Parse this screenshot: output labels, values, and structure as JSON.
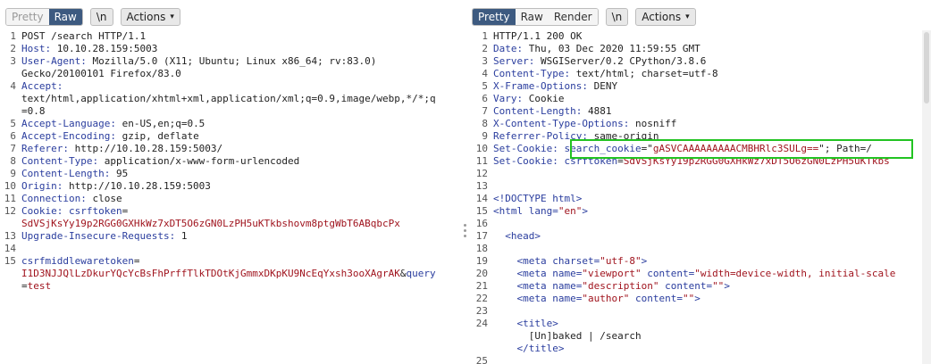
{
  "request": {
    "toolbar": {
      "pretty": "Pretty",
      "raw": "Raw",
      "newline": "\\n",
      "actions": "Actions"
    },
    "lines": [
      {
        "n": "1",
        "parts": [
          {
            "c": "v",
            "t": "POST /search HTTP/1.1"
          }
        ]
      },
      {
        "n": "2",
        "parts": [
          {
            "c": "k",
            "t": "Host: "
          },
          {
            "c": "v",
            "t": "10.10.28.159:5003"
          }
        ]
      },
      {
        "n": "3",
        "parts": [
          {
            "c": "k",
            "t": "User-Agent: "
          },
          {
            "c": "v",
            "t": "Mozilla/5.0 (X11; Ubuntu; Linux x86_64; rv:83.0)"
          }
        ]
      },
      {
        "n": "",
        "parts": [
          {
            "c": "v",
            "t": "Gecko/20100101 Firefox/83.0"
          }
        ]
      },
      {
        "n": "4",
        "parts": [
          {
            "c": "k",
            "t": "Accept: "
          }
        ]
      },
      {
        "n": "",
        "parts": [
          {
            "c": "v",
            "t": "text/html,application/xhtml+xml,application/xml;q=0.9,image/webp,*/*;q"
          }
        ]
      },
      {
        "n": "",
        "parts": [
          {
            "c": "v",
            "t": "=0.8"
          }
        ]
      },
      {
        "n": "5",
        "parts": [
          {
            "c": "k",
            "t": "Accept-Language: "
          },
          {
            "c": "v",
            "t": "en-US,en;q=0.5"
          }
        ]
      },
      {
        "n": "6",
        "parts": [
          {
            "c": "k",
            "t": "Accept-Encoding: "
          },
          {
            "c": "v",
            "t": "gzip, deflate"
          }
        ]
      },
      {
        "n": "7",
        "parts": [
          {
            "c": "k",
            "t": "Referer: "
          },
          {
            "c": "v",
            "t": "http://10.10.28.159:5003/"
          }
        ]
      },
      {
        "n": "8",
        "parts": [
          {
            "c": "k",
            "t": "Content-Type: "
          },
          {
            "c": "v",
            "t": "application/x-www-form-urlencoded"
          }
        ]
      },
      {
        "n": "9",
        "parts": [
          {
            "c": "k",
            "t": "Content-Length: "
          },
          {
            "c": "v",
            "t": "95"
          }
        ]
      },
      {
        "n": "10",
        "parts": [
          {
            "c": "k",
            "t": "Origin: "
          },
          {
            "c": "v",
            "t": "http://10.10.28.159:5003"
          }
        ]
      },
      {
        "n": "11",
        "parts": [
          {
            "c": "k",
            "t": "Connection: "
          },
          {
            "c": "v",
            "t": "close"
          }
        ]
      },
      {
        "n": "12",
        "parts": [
          {
            "c": "k",
            "t": "Cookie: "
          },
          {
            "c": "k",
            "t": "csrftoken"
          },
          {
            "c": "v",
            "t": "="
          }
        ]
      },
      {
        "n": "",
        "parts": [
          {
            "c": "r",
            "t": "SdVSjKsYy19p2RGG0GXHkWz7xDT5O6zGN0LzPH5uKTkbshovm8ptgWbT6ABqbcPx"
          }
        ]
      },
      {
        "n": "13",
        "parts": [
          {
            "c": "k",
            "t": "Upgrade-Insecure-Requests: "
          },
          {
            "c": "v",
            "t": "1"
          }
        ]
      },
      {
        "n": "14",
        "parts": []
      },
      {
        "n": "15",
        "parts": [
          {
            "c": "k",
            "t": "csrfmiddlewaretoken"
          },
          {
            "c": "v",
            "t": "="
          }
        ]
      },
      {
        "n": "",
        "parts": [
          {
            "c": "r",
            "t": "I1D3NJJQlLzDkurYQcYcBsFhPrffTlkTDOtKjGmmxDKpKU9NcEqYxsh3ooXAgrAK"
          },
          {
            "c": "v",
            "t": "&"
          },
          {
            "c": "k",
            "t": "query"
          }
        ]
      },
      {
        "n": "",
        "parts": [
          {
            "c": "v",
            "t": "="
          },
          {
            "c": "r",
            "t": "test"
          }
        ]
      }
    ]
  },
  "response": {
    "toolbar": {
      "pretty": "Pretty",
      "raw": "Raw",
      "render": "Render",
      "newline": "\\n",
      "actions": "Actions"
    },
    "lines": [
      {
        "n": "1",
        "parts": [
          {
            "c": "v",
            "t": "HTTP/1.1 200 OK"
          }
        ]
      },
      {
        "n": "2",
        "parts": [
          {
            "c": "k",
            "t": "Date: "
          },
          {
            "c": "v",
            "t": "Thu, 03 Dec 2020 11:59:55 GMT"
          }
        ]
      },
      {
        "n": "3",
        "parts": [
          {
            "c": "k",
            "t": "Server: "
          },
          {
            "c": "v",
            "t": "WSGIServer/0.2 CPython/3.8.6"
          }
        ]
      },
      {
        "n": "4",
        "parts": [
          {
            "c": "k",
            "t": "Content-Type: "
          },
          {
            "c": "v",
            "t": "text/html; charset=utf-8"
          }
        ]
      },
      {
        "n": "5",
        "parts": [
          {
            "c": "k",
            "t": "X-Frame-Options: "
          },
          {
            "c": "v",
            "t": "DENY"
          }
        ]
      },
      {
        "n": "6",
        "parts": [
          {
            "c": "k",
            "t": "Vary: "
          },
          {
            "c": "v",
            "t": "Cookie"
          }
        ]
      },
      {
        "n": "7",
        "parts": [
          {
            "c": "k",
            "t": "Content-Length: "
          },
          {
            "c": "v",
            "t": "4881"
          }
        ]
      },
      {
        "n": "8",
        "parts": [
          {
            "c": "k",
            "t": "X-Content-Type-Options: "
          },
          {
            "c": "v",
            "t": "nosniff"
          }
        ]
      },
      {
        "n": "9",
        "parts": [
          {
            "c": "k",
            "t": "Referrer-Policy: "
          },
          {
            "c": "v",
            "t": "same-origin"
          }
        ]
      },
      {
        "n": "10",
        "parts": [
          {
            "c": "k",
            "t": "Set-Cookie: "
          },
          {
            "c": "k",
            "t": "search_cookie"
          },
          {
            "c": "v",
            "t": "=\""
          },
          {
            "c": "r",
            "t": "gASVCAAAAAAAAACMBHRlc3SULg=="
          },
          {
            "c": "v",
            "t": "\"; Path=/"
          }
        ]
      },
      {
        "n": "11",
        "parts": [
          {
            "c": "k",
            "t": "Set-Cookie: "
          },
          {
            "c": "k",
            "t": "csrftoken"
          },
          {
            "c": "v",
            "t": "="
          },
          {
            "c": "r",
            "t": "SdVSjKsYy19p2RGG0GXHkWz7xDT5O6zGN0LzPH5uKTkbs"
          }
        ]
      },
      {
        "n": "12",
        "parts": []
      },
      {
        "n": "13",
        "parts": []
      },
      {
        "n": "14",
        "parts": [
          {
            "c": "t",
            "t": "<!DOCTYPE html>"
          }
        ]
      },
      {
        "n": "15",
        "parts": [
          {
            "c": "t",
            "t": "<html "
          },
          {
            "c": "a",
            "t": "lang"
          },
          {
            "c": "t",
            "t": "="
          },
          {
            "c": "s",
            "t": "\"en\""
          },
          {
            "c": "t",
            "t": ">"
          }
        ]
      },
      {
        "n": "16",
        "parts": []
      },
      {
        "n": "17",
        "parts": [
          {
            "c": "t",
            "t": "  <head>"
          }
        ]
      },
      {
        "n": "18",
        "parts": []
      },
      {
        "n": "19",
        "parts": [
          {
            "c": "t",
            "t": "    <meta "
          },
          {
            "c": "a",
            "t": "charset"
          },
          {
            "c": "t",
            "t": "="
          },
          {
            "c": "s",
            "t": "\"utf-8\""
          },
          {
            "c": "t",
            "t": ">"
          }
        ]
      },
      {
        "n": "20",
        "parts": [
          {
            "c": "t",
            "t": "    <meta "
          },
          {
            "c": "a",
            "t": "name"
          },
          {
            "c": "t",
            "t": "="
          },
          {
            "c": "s",
            "t": "\"viewport\""
          },
          {
            "c": "t",
            "t": " "
          },
          {
            "c": "a",
            "t": "content"
          },
          {
            "c": "t",
            "t": "="
          },
          {
            "c": "s",
            "t": "\"width=device-width, initial-scale"
          }
        ]
      },
      {
        "n": "21",
        "parts": [
          {
            "c": "t",
            "t": "    <meta "
          },
          {
            "c": "a",
            "t": "name"
          },
          {
            "c": "t",
            "t": "="
          },
          {
            "c": "s",
            "t": "\"description\""
          },
          {
            "c": "t",
            "t": " "
          },
          {
            "c": "a",
            "t": "content"
          },
          {
            "c": "t",
            "t": "="
          },
          {
            "c": "s",
            "t": "\"\""
          },
          {
            "c": "t",
            "t": ">"
          }
        ]
      },
      {
        "n": "22",
        "parts": [
          {
            "c": "t",
            "t": "    <meta "
          },
          {
            "c": "a",
            "t": "name"
          },
          {
            "c": "t",
            "t": "="
          },
          {
            "c": "s",
            "t": "\"author\""
          },
          {
            "c": "t",
            "t": " "
          },
          {
            "c": "a",
            "t": "content"
          },
          {
            "c": "t",
            "t": "="
          },
          {
            "c": "s",
            "t": "\"\""
          },
          {
            "c": "t",
            "t": ">"
          }
        ]
      },
      {
        "n": "23",
        "parts": []
      },
      {
        "n": "24",
        "parts": [
          {
            "c": "t",
            "t": "    <title>"
          }
        ]
      },
      {
        "n": "",
        "parts": [
          {
            "c": "v",
            "t": "      [Un]baked | /search"
          }
        ]
      },
      {
        "n": "",
        "parts": [
          {
            "c": "t",
            "t": "    </title>"
          }
        ]
      },
      {
        "n": "25",
        "parts": []
      }
    ]
  },
  "colors": {
    "highlight": "#22c322",
    "active_tab": "#3d5a80",
    "header_key": "#2a3d9e",
    "value_red": "#a0141e"
  }
}
